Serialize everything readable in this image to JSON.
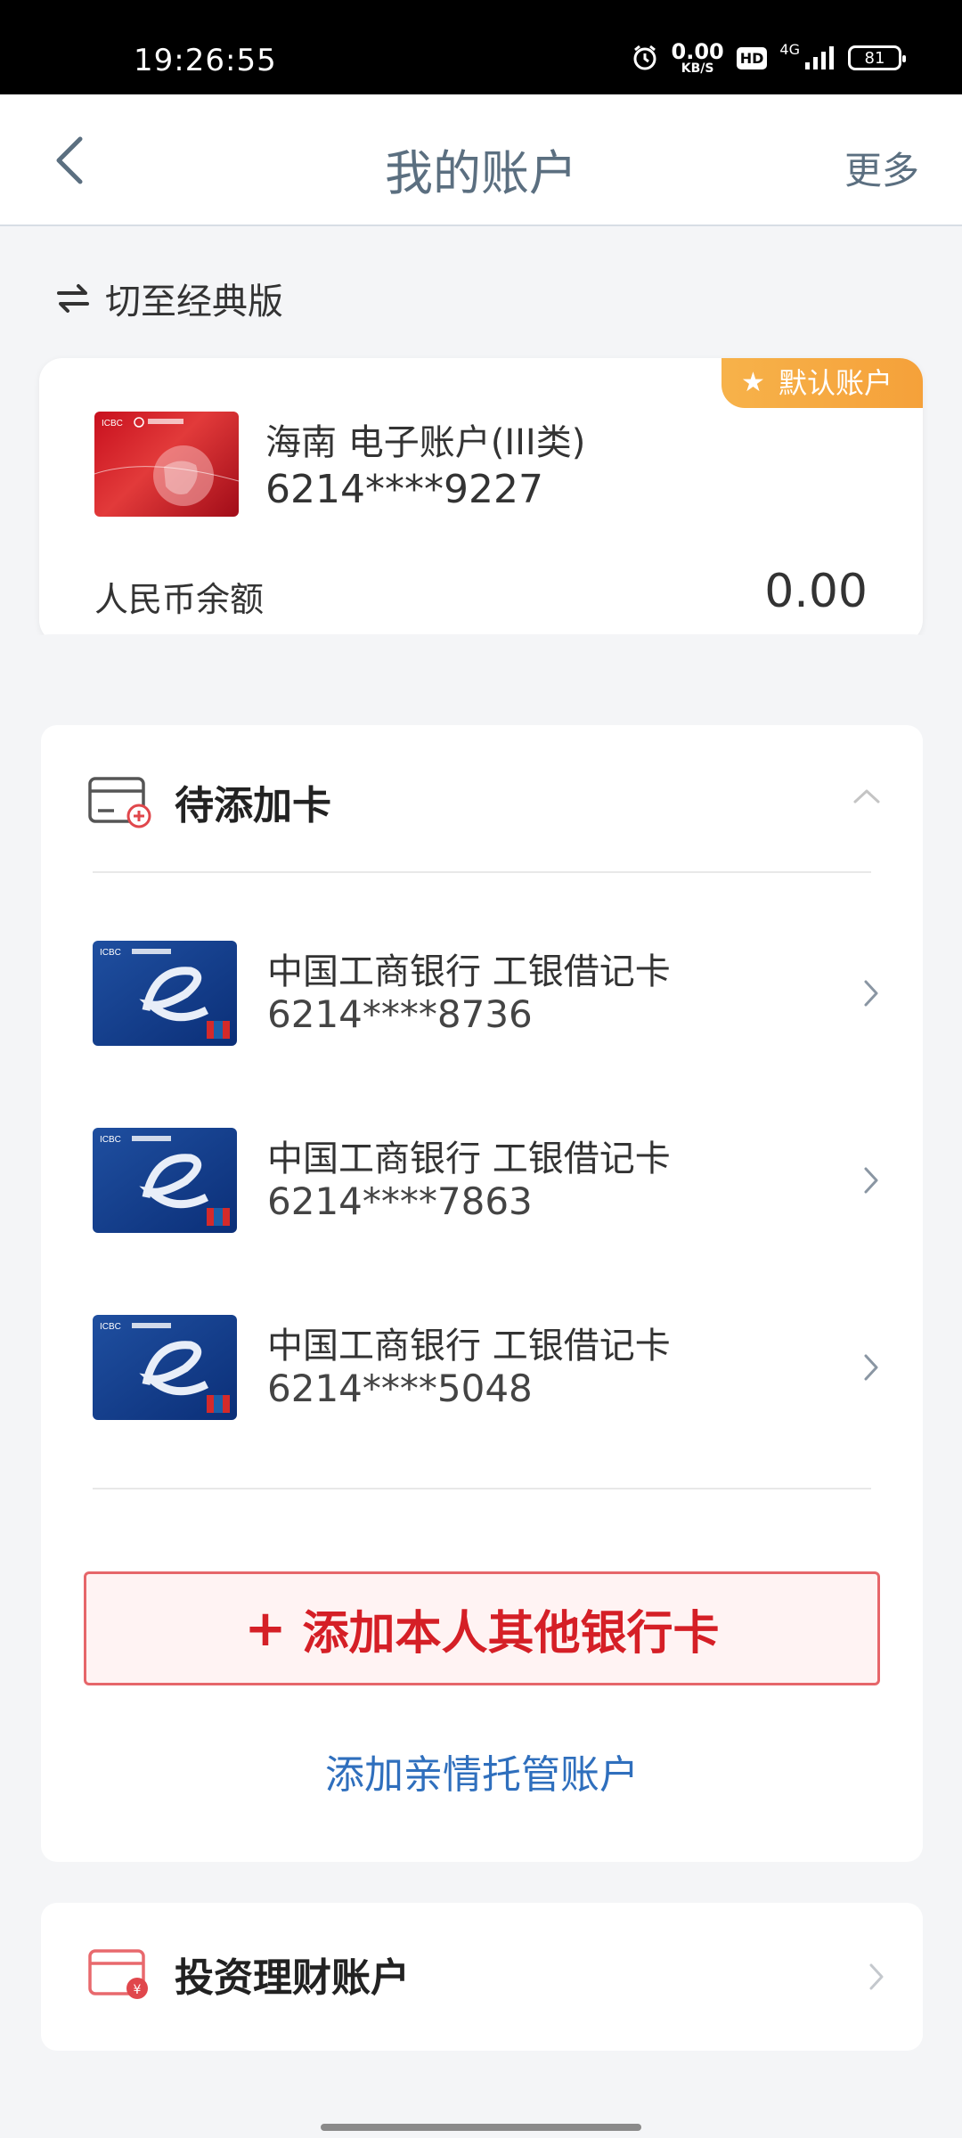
{
  "status_bar": {
    "time": "19:26:55",
    "net_speed_value": "0.00",
    "net_speed_unit": "KB/S",
    "hd_label": "HD",
    "network_label": "4G",
    "battery_level": "81"
  },
  "header": {
    "title": "我的账户",
    "more_label": "更多"
  },
  "switch_version": {
    "label": "切至经典版"
  },
  "default_account": {
    "badge": "默认账户",
    "name": "海南 电子账户(III类)",
    "number": "6214****9227",
    "balance_label": "人民币余额",
    "balance_value": "0.00"
  },
  "pending_cards": {
    "title": "待添加卡",
    "items": [
      {
        "bank": "中国工商银行 工银借记卡",
        "number": "6214****8736"
      },
      {
        "bank": "中国工商银行 工银借记卡",
        "number": "6214****7863"
      },
      {
        "bank": "中国工商银行 工银借记卡",
        "number": "6214****5048"
      }
    ],
    "add_button_label": "添加本人其他银行卡",
    "family_link_label": "添加亲情托管账户"
  },
  "invest_section": {
    "title": "投资理财账户"
  },
  "colors": {
    "accent_red": "#d51f26",
    "link_blue": "#2f6fbd",
    "badge_orange": "#f5a13a",
    "title_gray": "#5b6f80"
  }
}
